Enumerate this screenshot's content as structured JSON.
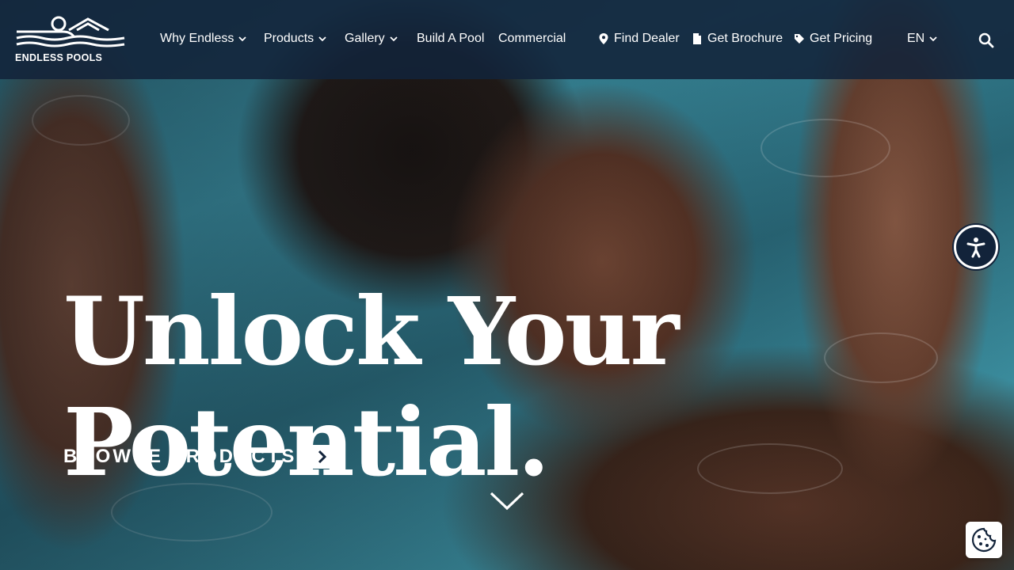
{
  "brand": {
    "logo_text": "ENDLESS POOLS"
  },
  "nav": {
    "why_endless": "Why Endless",
    "products": "Products",
    "gallery": "Gallery",
    "build_a_pool": "Build A Pool",
    "commercial": "Commercial",
    "find_dealer": "Find Dealer",
    "get_brochure": "Get Brochure",
    "get_pricing": "Get Pricing",
    "language": "EN"
  },
  "hero": {
    "headline_line1": "Unlock Your",
    "headline_line2": "Potential.",
    "cta_label": "BROWSE PRODUCTS"
  },
  "colors": {
    "nav_bg": "#12233a",
    "text": "#ffffff",
    "water": "#3b8fa1"
  },
  "icons": {
    "search": "search-icon",
    "location": "map-pin-icon",
    "brochure": "document-icon",
    "pricing": "tag-icon",
    "accessibility": "accessibility-icon",
    "cookie": "cookie-icon"
  }
}
